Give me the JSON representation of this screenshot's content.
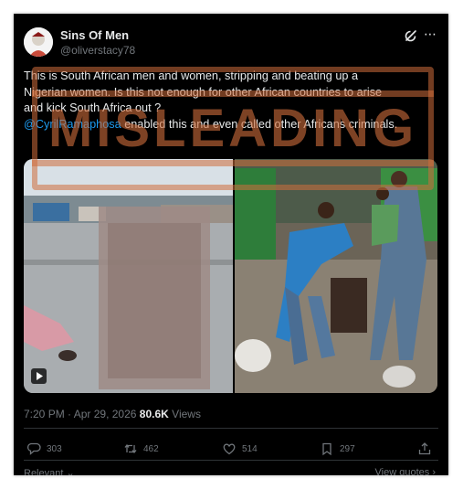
{
  "post": {
    "author_name": "Sins Of Men",
    "author_handle": "@oliverstacy78",
    "text_lines": [
      "This is South African men and women, stripping and beating up a",
      "Nigerian women. Is this not enough for other African countries to arise",
      "and kick South Africa out ?"
    ],
    "mention": "@CyrilRamaphosa",
    "text_tail": " enabled this and even called other Africans criminals.",
    "stamp_label": "MISLEADING",
    "time": "7:20 PM",
    "date_separator": "·",
    "date": "Apr 29, 2026",
    "views_separator": "·",
    "views_count": "80.6K",
    "views_label": "Views"
  },
  "actions": {
    "replies": "303",
    "reposts": "462",
    "likes": "514",
    "bookmarks": "297"
  },
  "footer": {
    "relevant_label": "Relevant",
    "view_quotes_label": "View quotes"
  },
  "icons": {
    "more": "more-icon",
    "grok": "grok-icon",
    "reply": "reply-icon",
    "repost": "repost-icon",
    "like": "heart-icon",
    "bookmark": "bookmark-icon",
    "share": "share-icon",
    "play": "play-icon"
  },
  "colors": {
    "background": "#000000",
    "text": "#e7e9ea",
    "secondary": "#71767b",
    "mention": "#1d9bf0",
    "stamp": "#d06e3c"
  }
}
